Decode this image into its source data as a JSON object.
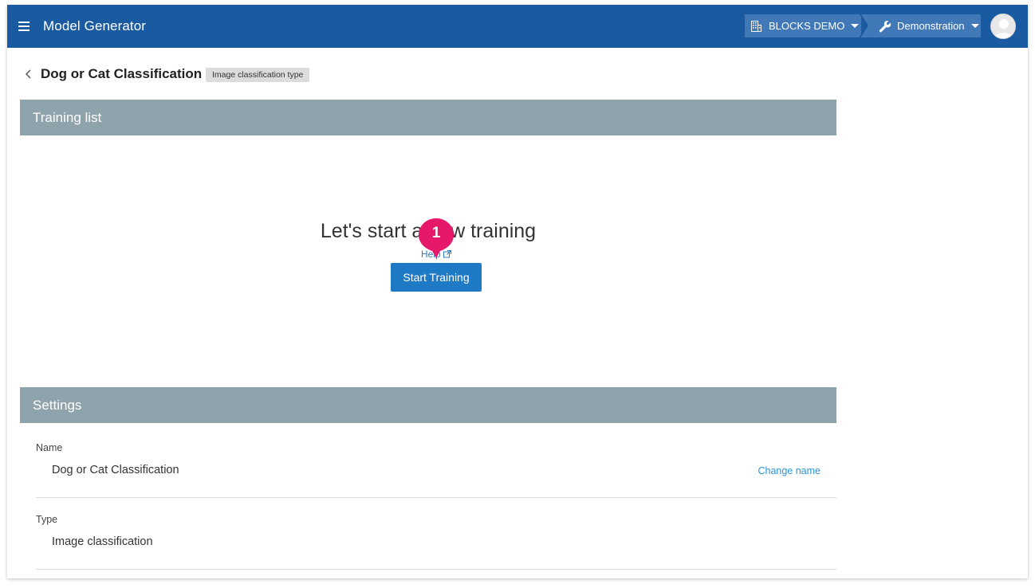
{
  "app": {
    "title": "Model Generator",
    "organization": "BLOCKS DEMO",
    "project": "Demonstration",
    "brand_color": "#1a5aa0",
    "chip_color": "#4179b8"
  },
  "page": {
    "title": "Dog or Cat Classification",
    "type_badge": "Image classification type"
  },
  "training_list": {
    "section_title": "Training list",
    "empty_heading": "Let's start a new training",
    "help_label": "Help",
    "start_button": "Start Training",
    "step_marker": "1"
  },
  "settings": {
    "section_title": "Settings",
    "name_label": "Name",
    "name_value": "Dog or Cat Classification",
    "change_name": "Change name",
    "type_label": "Type",
    "type_value": "Image classification"
  }
}
